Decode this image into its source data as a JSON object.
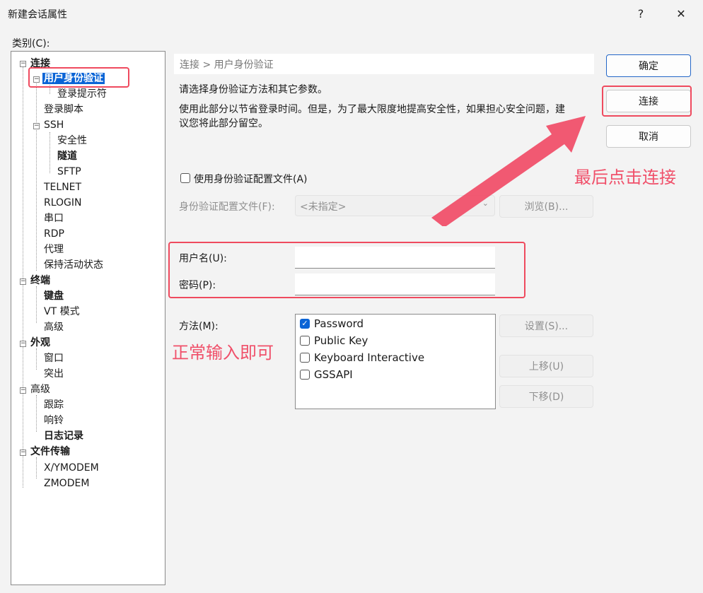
{
  "window": {
    "title": "新建会话属性",
    "help_glyph": "?",
    "close_glyph": "✕"
  },
  "category_label": "类别(C):",
  "tree": {
    "connection": "连接",
    "user_auth": "用户身份验证",
    "login_prompt": "登录提示符",
    "login_script": "登录脚本",
    "ssh": "SSH",
    "security": "安全性",
    "tunnel": "隧道",
    "sftp": "SFTP",
    "telnet": "TELNET",
    "rlogin": "RLOGIN",
    "serial": "串口",
    "rdp": "RDP",
    "proxy": "代理",
    "keepalive": "保持活动状态",
    "terminal": "终端",
    "keyboard": "键盘",
    "vt_mode": "VT 模式",
    "advanced1": "高级",
    "appearance": "外观",
    "window": "窗口",
    "highlight": "突出",
    "advanced": "高级",
    "trace": "跟踪",
    "bell": "响铃",
    "logging": "日志记录",
    "file_transfer": "文件传输",
    "xymodem": "X/YMODEM",
    "zmodem": "ZMODEM"
  },
  "breadcrumb": "连接 > 用户身份验证",
  "desc1": "请选择身份验证方法和其它参数。",
  "desc2": "使用此部分以节省登录时间。但是，为了最大限度地提高安全性，如果担心安全问题，建",
  "desc3": "议您将此部分留空。",
  "use_profile_label": "使用身份验证配置文件(A)",
  "profile_label": "身份验证配置文件(F):",
  "profile_value": "<未指定>",
  "browse_button": "浏览(B)...",
  "username_label": "用户名(U):",
  "password_label": "密码(P):",
  "username_value": "",
  "password_value": "",
  "method_label": "方法(M):",
  "methods": [
    {
      "label": "Password",
      "checked": true
    },
    {
      "label": "Public Key",
      "checked": false
    },
    {
      "label": "Keyboard Interactive",
      "checked": false
    },
    {
      "label": "GSSAPI",
      "checked": false
    }
  ],
  "settings_button": "设置(S)...",
  "move_up_button": "上移(U)",
  "move_down_button": "下移(D)",
  "ok_button": "确定",
  "connect_button": "连接",
  "cancel_button": "取消",
  "annotation_connect": "最后点击连接",
  "annotation_input": "正常输入即可",
  "colors": {
    "accent": "#0a64d6",
    "annotation": "#f0506a"
  }
}
